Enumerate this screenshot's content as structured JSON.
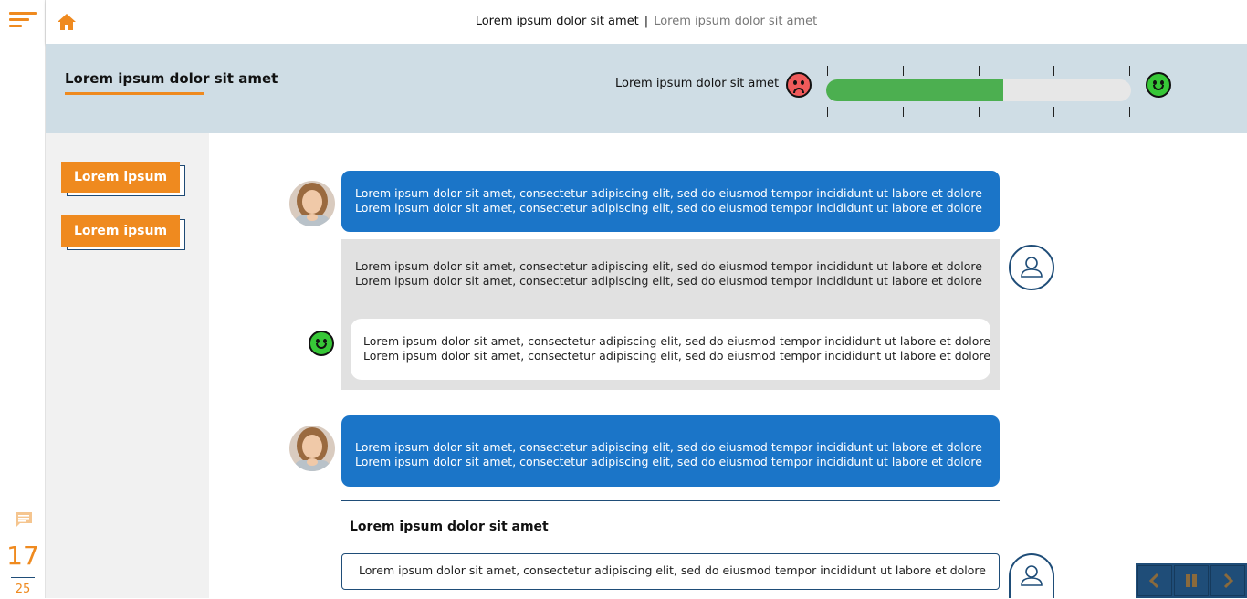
{
  "breadcrumb": {
    "current": "Lorem ipsum dolor sit amet",
    "separator": "|",
    "next": "Lorem ipsum dolor sit amet"
  },
  "header": {
    "title": "Lorem ipsum dolor sit amet",
    "meter_label": "Lorem ipsum dolor sit amet",
    "meter_level_fraction": 0.58,
    "meter_ticks": 5
  },
  "sidebar": {
    "buttons": [
      {
        "label": "Lorem ipsum"
      },
      {
        "label": "Lorem ipsum"
      }
    ]
  },
  "chat": {
    "message1": {
      "line1": "Lorem ipsum dolor sit amet, consectetur adipiscing elit, sed do eiusmod tempor incididunt ut labore et dolore",
      "line2": "Lorem ipsum dolor sit amet, consectetur adipiscing elit, sed do eiusmod tempor incididunt ut labore et dolore"
    },
    "response_gray": {
      "line1": "Lorem ipsum dolor sit amet, consectetur adipiscing elit, sed do eiusmod tempor incididunt ut labore et dolore",
      "line2": "Lorem ipsum dolor sit amet, consectetur adipiscing elit, sed do eiusmod tempor incididunt ut labore et dolore"
    },
    "feedback_card": {
      "line1": "Lorem ipsum dolor sit amet, consectetur adipiscing elit, sed do eiusmod tempor incididunt ut labore et dolore",
      "line2": "Lorem ipsum dolor sit amet, consectetur adipiscing elit, sed do eiusmod tempor incididunt ut labore et dolore"
    },
    "message2": {
      "line1": "Lorem ipsum dolor sit amet, consectetur adipiscing elit, sed do eiusmod tempor incididunt ut labore et dolore",
      "line2": "Lorem ipsum dolor sit amet, consectetur adipiscing elit, sed do eiusmod tempor incididunt ut labore et dolore"
    },
    "section_title": "Lorem ipsum dolor sit amet",
    "answer_option": "Lorem ipsum dolor sit amet, consectetur adipiscing elit, sed do eiusmod tempor incididunt ut labore et dolore"
  },
  "pager": {
    "current": "17",
    "total": "25"
  },
  "colors": {
    "accent": "#ef8a1f",
    "navy": "#1f4d78",
    "bubble_blue": "#1b75c8",
    "meter_green": "#4caf50",
    "sad_red": "#ef5a5a",
    "happy_green": "#37c737"
  },
  "icons": {
    "menu": "menu-lines-icon",
    "home": "home-icon",
    "comment": "comment-icon",
    "user": "user-icon",
    "prev": "chevron-left-icon",
    "pause": "pause-icon",
    "next": "chevron-right-icon"
  }
}
